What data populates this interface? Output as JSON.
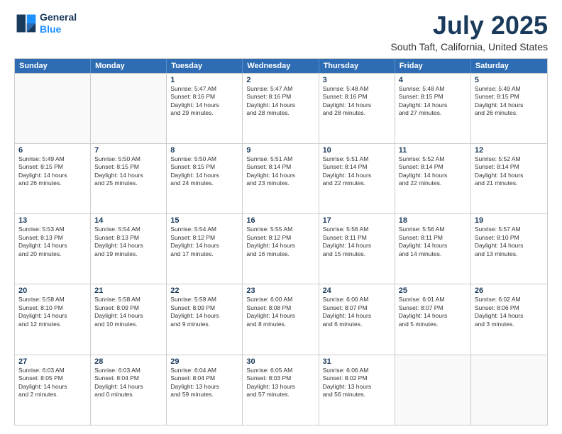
{
  "header": {
    "logo_line1": "General",
    "logo_line2": "Blue",
    "month": "July 2025",
    "location": "South Taft, California, United States"
  },
  "days_of_week": [
    "Sunday",
    "Monday",
    "Tuesday",
    "Wednesday",
    "Thursday",
    "Friday",
    "Saturday"
  ],
  "weeks": [
    [
      {
        "day": "",
        "lines": []
      },
      {
        "day": "",
        "lines": []
      },
      {
        "day": "1",
        "lines": [
          "Sunrise: 5:47 AM",
          "Sunset: 8:16 PM",
          "Daylight: 14 hours",
          "and 29 minutes."
        ]
      },
      {
        "day": "2",
        "lines": [
          "Sunrise: 5:47 AM",
          "Sunset: 8:16 PM",
          "Daylight: 14 hours",
          "and 28 minutes."
        ]
      },
      {
        "day": "3",
        "lines": [
          "Sunrise: 5:48 AM",
          "Sunset: 8:16 PM",
          "Daylight: 14 hours",
          "and 28 minutes."
        ]
      },
      {
        "day": "4",
        "lines": [
          "Sunrise: 5:48 AM",
          "Sunset: 8:15 PM",
          "Daylight: 14 hours",
          "and 27 minutes."
        ]
      },
      {
        "day": "5",
        "lines": [
          "Sunrise: 5:49 AM",
          "Sunset: 8:15 PM",
          "Daylight: 14 hours",
          "and 26 minutes."
        ]
      }
    ],
    [
      {
        "day": "6",
        "lines": [
          "Sunrise: 5:49 AM",
          "Sunset: 8:15 PM",
          "Daylight: 14 hours",
          "and 26 minutes."
        ]
      },
      {
        "day": "7",
        "lines": [
          "Sunrise: 5:50 AM",
          "Sunset: 8:15 PM",
          "Daylight: 14 hours",
          "and 25 minutes."
        ]
      },
      {
        "day": "8",
        "lines": [
          "Sunrise: 5:50 AM",
          "Sunset: 8:15 PM",
          "Daylight: 14 hours",
          "and 24 minutes."
        ]
      },
      {
        "day": "9",
        "lines": [
          "Sunrise: 5:51 AM",
          "Sunset: 8:14 PM",
          "Daylight: 14 hours",
          "and 23 minutes."
        ]
      },
      {
        "day": "10",
        "lines": [
          "Sunrise: 5:51 AM",
          "Sunset: 8:14 PM",
          "Daylight: 14 hours",
          "and 22 minutes."
        ]
      },
      {
        "day": "11",
        "lines": [
          "Sunrise: 5:52 AM",
          "Sunset: 8:14 PM",
          "Daylight: 14 hours",
          "and 22 minutes."
        ]
      },
      {
        "day": "12",
        "lines": [
          "Sunrise: 5:52 AM",
          "Sunset: 8:14 PM",
          "Daylight: 14 hours",
          "and 21 minutes."
        ]
      }
    ],
    [
      {
        "day": "13",
        "lines": [
          "Sunrise: 5:53 AM",
          "Sunset: 8:13 PM",
          "Daylight: 14 hours",
          "and 20 minutes."
        ]
      },
      {
        "day": "14",
        "lines": [
          "Sunrise: 5:54 AM",
          "Sunset: 8:13 PM",
          "Daylight: 14 hours",
          "and 19 minutes."
        ]
      },
      {
        "day": "15",
        "lines": [
          "Sunrise: 5:54 AM",
          "Sunset: 8:12 PM",
          "Daylight: 14 hours",
          "and 17 minutes."
        ]
      },
      {
        "day": "16",
        "lines": [
          "Sunrise: 5:55 AM",
          "Sunset: 8:12 PM",
          "Daylight: 14 hours",
          "and 16 minutes."
        ]
      },
      {
        "day": "17",
        "lines": [
          "Sunrise: 5:56 AM",
          "Sunset: 8:11 PM",
          "Daylight: 14 hours",
          "and 15 minutes."
        ]
      },
      {
        "day": "18",
        "lines": [
          "Sunrise: 5:56 AM",
          "Sunset: 8:11 PM",
          "Daylight: 14 hours",
          "and 14 minutes."
        ]
      },
      {
        "day": "19",
        "lines": [
          "Sunrise: 5:57 AM",
          "Sunset: 8:10 PM",
          "Daylight: 14 hours",
          "and 13 minutes."
        ]
      }
    ],
    [
      {
        "day": "20",
        "lines": [
          "Sunrise: 5:58 AM",
          "Sunset: 8:10 PM",
          "Daylight: 14 hours",
          "and 12 minutes."
        ]
      },
      {
        "day": "21",
        "lines": [
          "Sunrise: 5:58 AM",
          "Sunset: 8:09 PM",
          "Daylight: 14 hours",
          "and 10 minutes."
        ]
      },
      {
        "day": "22",
        "lines": [
          "Sunrise: 5:59 AM",
          "Sunset: 8:09 PM",
          "Daylight: 14 hours",
          "and 9 minutes."
        ]
      },
      {
        "day": "23",
        "lines": [
          "Sunrise: 6:00 AM",
          "Sunset: 8:08 PM",
          "Daylight: 14 hours",
          "and 8 minutes."
        ]
      },
      {
        "day": "24",
        "lines": [
          "Sunrise: 6:00 AM",
          "Sunset: 8:07 PM",
          "Daylight: 14 hours",
          "and 6 minutes."
        ]
      },
      {
        "day": "25",
        "lines": [
          "Sunrise: 6:01 AM",
          "Sunset: 8:07 PM",
          "Daylight: 14 hours",
          "and 5 minutes."
        ]
      },
      {
        "day": "26",
        "lines": [
          "Sunrise: 6:02 AM",
          "Sunset: 8:06 PM",
          "Daylight: 14 hours",
          "and 3 minutes."
        ]
      }
    ],
    [
      {
        "day": "27",
        "lines": [
          "Sunrise: 6:03 AM",
          "Sunset: 8:05 PM",
          "Daylight: 14 hours",
          "and 2 minutes."
        ]
      },
      {
        "day": "28",
        "lines": [
          "Sunrise: 6:03 AM",
          "Sunset: 8:04 PM",
          "Daylight: 14 hours",
          "and 0 minutes."
        ]
      },
      {
        "day": "29",
        "lines": [
          "Sunrise: 6:04 AM",
          "Sunset: 8:04 PM",
          "Daylight: 13 hours",
          "and 59 minutes."
        ]
      },
      {
        "day": "30",
        "lines": [
          "Sunrise: 6:05 AM",
          "Sunset: 8:03 PM",
          "Daylight: 13 hours",
          "and 57 minutes."
        ]
      },
      {
        "day": "31",
        "lines": [
          "Sunrise: 6:06 AM",
          "Sunset: 8:02 PM",
          "Daylight: 13 hours",
          "and 56 minutes."
        ]
      },
      {
        "day": "",
        "lines": []
      },
      {
        "day": "",
        "lines": []
      }
    ]
  ]
}
